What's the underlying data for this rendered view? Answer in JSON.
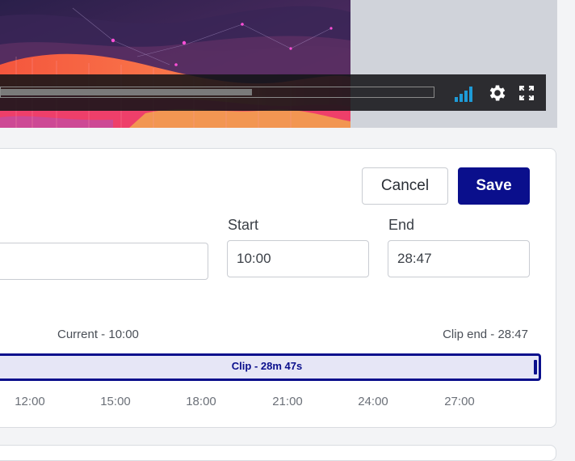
{
  "player": {
    "progress_fraction": 0.58,
    "icons": [
      "signal-bars-icon",
      "gear-icon",
      "fullscreen-icon"
    ],
    "colors": {
      "signal": "#1e9bd7",
      "bar_bg": "#141418"
    }
  },
  "editor": {
    "cancel_label": "Cancel",
    "save_label": "Save",
    "start_label": "Start",
    "start_value": "10:00",
    "end_label": "End",
    "end_value": "28:47",
    "title_value": "",
    "current_caption": "Current - 10:00",
    "clip_end_caption": "Clip end - 28:47",
    "clip_label": "Clip - 28m 47s",
    "ticks": [
      "12:00",
      "15:00",
      "18:00",
      "21:00",
      "24:00",
      "27:00"
    ],
    "colors": {
      "accent": "#0a0f8c",
      "clip_fill": "#e6e6f6"
    }
  }
}
